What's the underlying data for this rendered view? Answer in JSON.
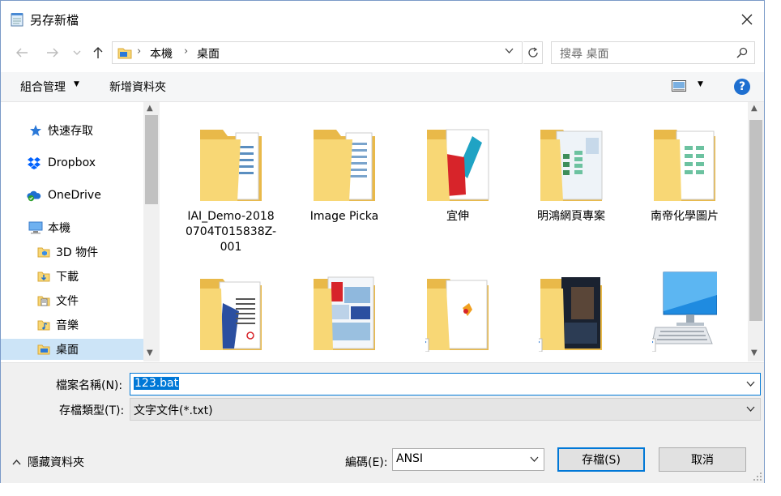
{
  "window": {
    "title": "另存新檔"
  },
  "address": {
    "crumbs": [
      "本機",
      "桌面"
    ]
  },
  "search": {
    "placeholder": "搜尋 桌面"
  },
  "toolbar": {
    "organize": "組合管理",
    "new_folder": "新增資料夾"
  },
  "nav": {
    "items": [
      {
        "label": "快速存取",
        "icon": "star-icon"
      },
      {
        "label": "Dropbox",
        "icon": "dropbox-icon"
      },
      {
        "label": "OneDrive",
        "icon": "onedrive-cloud-icon"
      },
      {
        "label": "本機",
        "icon": "computer-icon"
      },
      {
        "label": "3D 物件",
        "icon": "3d-objects-icon"
      },
      {
        "label": "下載",
        "icon": "download-folder-icon"
      },
      {
        "label": "文件",
        "icon": "documents-icon"
      },
      {
        "label": "音樂",
        "icon": "music-icon"
      },
      {
        "label": "桌面",
        "icon": "desktop-folder-icon",
        "selected": true
      }
    ]
  },
  "files": [
    {
      "caption": "IAI_Demo-2018\n0704T015838Z-\n001",
      "icon": "folder-icon"
    },
    {
      "caption": "Image Picka",
      "icon": "folder-icon"
    },
    {
      "caption": "宜伸",
      "icon": "folder-icon"
    },
    {
      "caption": "明鴻網頁專案",
      "icon": "folder-icon"
    },
    {
      "caption": "南帝化學圖片",
      "icon": "folder-icon"
    },
    {
      "caption": "",
      "icon": "folder-icon"
    },
    {
      "caption": "",
      "icon": "folder-icon"
    },
    {
      "caption": "",
      "icon": "shortcut-folder-icon"
    },
    {
      "caption": "",
      "icon": "shortcut-folder-icon"
    },
    {
      "caption": "",
      "icon": "this-pc-shortcut-icon"
    }
  ],
  "form": {
    "filename_label": "檔案名稱(N):",
    "filename_value": "123.bat",
    "filetype_label": "存檔類型(T):",
    "filetype_value": "文字文件(*.txt)",
    "encoding_label": "編碼(E):",
    "encoding_value": "ANSI",
    "save_label": "存檔(S)",
    "cancel_label": "取消",
    "hide_folders_label": "隱藏資料夾"
  },
  "colors": {
    "accent": "#0078d7",
    "selection": "#cce4f7",
    "folder": "#f8d775"
  }
}
